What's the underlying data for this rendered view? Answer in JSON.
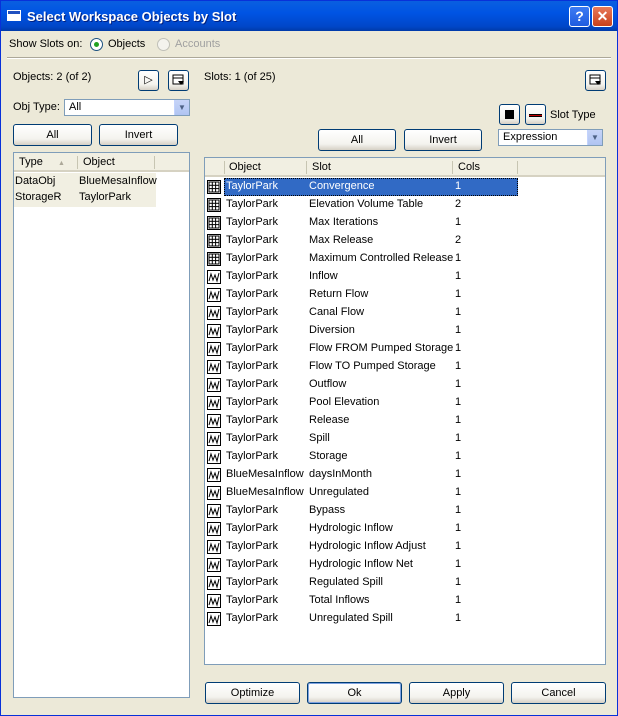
{
  "window": {
    "title": "Select Workspace Objects by Slot",
    "help_glyph": "?",
    "close_glyph": "✕"
  },
  "show_slots": {
    "label": "Show Slots on:",
    "options": [
      {
        "label": "Objects",
        "selected": true,
        "enabled": true
      },
      {
        "label": "Accounts",
        "selected": false,
        "enabled": false
      }
    ]
  },
  "left_panel": {
    "count_label": "Objects: 2 (of 2)",
    "obj_type_label": "Obj Type:",
    "obj_type_value": "All",
    "all_button": "All",
    "invert_button": "Invert",
    "columns": [
      "Type",
      "Object"
    ],
    "rows": [
      {
        "type": "DataObj",
        "object": "BlueMesaInflow"
      },
      {
        "type": "StorageR",
        "object": "TaylorPark"
      }
    ]
  },
  "right_panel": {
    "count_label": "Slots: 1 (of 25)",
    "slot_type_label": "Slot Type",
    "slot_type_value": "Expression",
    "all_button": "All",
    "invert_button": "Invert",
    "columns": [
      "Object",
      "Slot",
      "Cols"
    ],
    "rows": [
      {
        "icon": "table",
        "object": "TaylorPark",
        "slot": "Convergence",
        "cols": "1",
        "selected": true
      },
      {
        "icon": "table",
        "object": "TaylorPark",
        "slot": "Elevation Volume Table",
        "cols": "2"
      },
      {
        "icon": "table",
        "object": "TaylorPark",
        "slot": "Max Iterations",
        "cols": "1"
      },
      {
        "icon": "table",
        "object": "TaylorPark",
        "slot": "Max Release",
        "cols": "2"
      },
      {
        "icon": "table",
        "object": "TaylorPark",
        "slot": "Maximum Controlled Release",
        "cols": "1"
      },
      {
        "icon": "series",
        "object": "TaylorPark",
        "slot": "Inflow",
        "cols": "1"
      },
      {
        "icon": "series",
        "object": "TaylorPark",
        "slot": "Return Flow",
        "cols": "1"
      },
      {
        "icon": "series",
        "object": "TaylorPark",
        "slot": "Canal Flow",
        "cols": "1"
      },
      {
        "icon": "series",
        "object": "TaylorPark",
        "slot": "Diversion",
        "cols": "1"
      },
      {
        "icon": "series",
        "object": "TaylorPark",
        "slot": "Flow FROM Pumped Storage",
        "cols": "1"
      },
      {
        "icon": "series",
        "object": "TaylorPark",
        "slot": "Flow TO Pumped Storage",
        "cols": "1"
      },
      {
        "icon": "series",
        "object": "TaylorPark",
        "slot": "Outflow",
        "cols": "1"
      },
      {
        "icon": "series",
        "object": "TaylorPark",
        "slot": "Pool Elevation",
        "cols": "1"
      },
      {
        "icon": "series",
        "object": "TaylorPark",
        "slot": "Release",
        "cols": "1"
      },
      {
        "icon": "series",
        "object": "TaylorPark",
        "slot": "Spill",
        "cols": "1"
      },
      {
        "icon": "series",
        "object": "TaylorPark",
        "slot": "Storage",
        "cols": "1"
      },
      {
        "icon": "series",
        "object": "BlueMesaInflow",
        "slot": "daysInMonth",
        "cols": "1"
      },
      {
        "icon": "series",
        "object": "BlueMesaInflow",
        "slot": "Unregulated",
        "cols": "1"
      },
      {
        "icon": "series",
        "object": "TaylorPark",
        "slot": "Bypass",
        "cols": "1"
      },
      {
        "icon": "series",
        "object": "TaylorPark",
        "slot": "Hydrologic Inflow",
        "cols": "1"
      },
      {
        "icon": "series",
        "object": "TaylorPark",
        "slot": "Hydrologic Inflow Adjust",
        "cols": "1"
      },
      {
        "icon": "series",
        "object": "TaylorPark",
        "slot": "Hydrologic Inflow Net",
        "cols": "1"
      },
      {
        "icon": "series",
        "object": "TaylorPark",
        "slot": "Regulated Spill",
        "cols": "1"
      },
      {
        "icon": "series",
        "object": "TaylorPark",
        "slot": "Total Inflows",
        "cols": "1"
      },
      {
        "icon": "series",
        "object": "TaylorPark",
        "slot": "Unregulated Spill",
        "cols": "1"
      }
    ]
  },
  "footer": {
    "optimize": "Optimize",
    "ok": "Ok",
    "apply": "Apply",
    "cancel": "Cancel"
  },
  "colors": {
    "selection": "#316ac5",
    "left_row_bg": "#f1efe2"
  }
}
